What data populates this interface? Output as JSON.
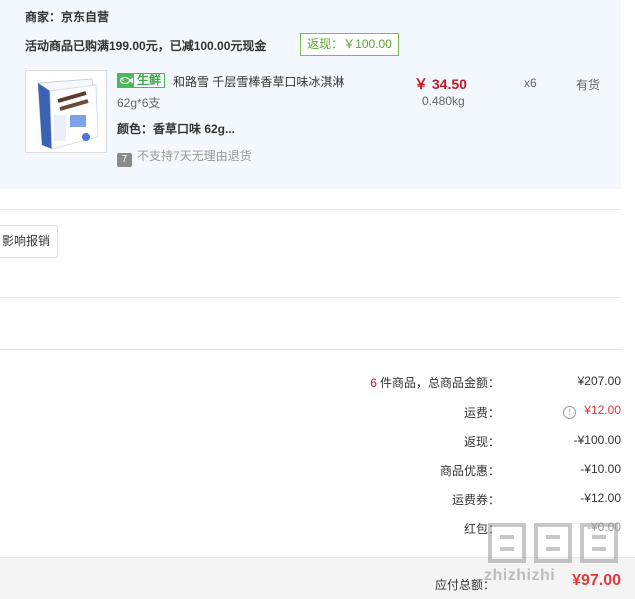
{
  "vendor": {
    "merchant": "商家：京东自营",
    "promo": "活动商品已购满199.00元，已减100.00元现金",
    "promo_badge": "返现：￥100.00"
  },
  "item": {
    "fresh_tag": "生鲜",
    "name": "和路雪 千层雪棒香草口味冰淇淋",
    "spec": "62g*6支",
    "color": "颜色：香草口味 62g...",
    "no_return_badge": "7",
    "no_return": "不支持7天无理由退货",
    "price": "￥ 34.50",
    "weight": "0.480kg",
    "qty": "x6",
    "stock": "有货",
    "icon": "ice-cream-box"
  },
  "actions": {
    "reimbursement": "影响报销"
  },
  "summary": {
    "count": "6",
    "goods_label": "件商品，总商品金额：",
    "goods_total": "¥207.00",
    "shipping_label": "运费：",
    "shipping": "¥12.00",
    "cashback_label": "返现：",
    "cashback": "-¥100.00",
    "discount_label": "商品优惠：",
    "discount": "-¥10.00",
    "coupon_label": "运费券：",
    "coupon": "-¥12.00",
    "redpacket_label": "红包：",
    "redpacket": "-¥0.00",
    "payable_label": "应付总额：",
    "payable": "¥97.00"
  },
  "watermark": {
    "text": "zhizhizhi"
  },
  "colors": {
    "accent_red": "#e4393c",
    "price_red": "#c81623",
    "fresh_green": "#4bb85a",
    "panel_bg": "#f3f8fe"
  }
}
